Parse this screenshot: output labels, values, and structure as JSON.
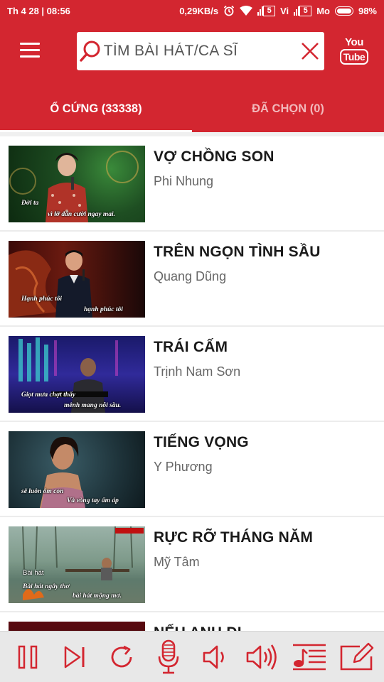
{
  "status_bar": {
    "datetime": "Th 4 28 | 08:56",
    "net_speed": "0,29KB/s",
    "sim1_label": "Vi",
    "sim2_label": "Mo",
    "sim_badge": "5",
    "battery": "98%"
  },
  "header": {
    "search_placeholder": "TÌM BÀI HÁT/CA SĨ",
    "youtube_top": "You",
    "youtube_bottom": "Tube"
  },
  "tabs": [
    {
      "label": "Ổ CỨNG (33338)",
      "active": true
    },
    {
      "label": "ĐÃ CHỌN (0)",
      "active": false
    }
  ],
  "songs": [
    {
      "title": "VỢ CHỒNG SON",
      "artist": "Phi Nhung",
      "subtitle_top": "Đời ta",
      "subtitle_bottom": "vì lỡ dấn cười ngay mai."
    },
    {
      "title": "TRÊN NGỌN TÌNH SẦU",
      "artist": "Quang Dũng",
      "subtitle_top": "Hạnh phúc tôi",
      "subtitle_bottom": "hạnh phúc tôi"
    },
    {
      "title": "TRÁI CẤM",
      "artist": "Trịnh Nam Sơn",
      "subtitle_top": "Giọt mưa chợt thấy",
      "subtitle_bottom": "mênh mang nỗi sầu."
    },
    {
      "title": "TIẾNG VỌNG",
      "artist": "Y Phương",
      "subtitle_top": "sẽ luôn ôm con",
      "subtitle_bottom": "Và vòng tay ấm áp"
    },
    {
      "title": "RỰC RỠ THÁNG NĂM",
      "artist": "Mỹ Tâm",
      "subtitle_top": "Bài hát",
      "subtitle_bottom": "Bài hát ngây thơ",
      "subtitle_extra": "bài hát mộng mơ."
    },
    {
      "title": "NẾU ANH ĐI",
      "artist": ""
    }
  ],
  "player_controls": [
    "pause-icon",
    "skip-next-icon",
    "replay-icon",
    "microphone-icon",
    "volume-down-icon",
    "volume-up-icon",
    "playlist-icon",
    "edit-icon"
  ],
  "colors": {
    "brand": "#d32630",
    "player_icon": "#d32630"
  }
}
